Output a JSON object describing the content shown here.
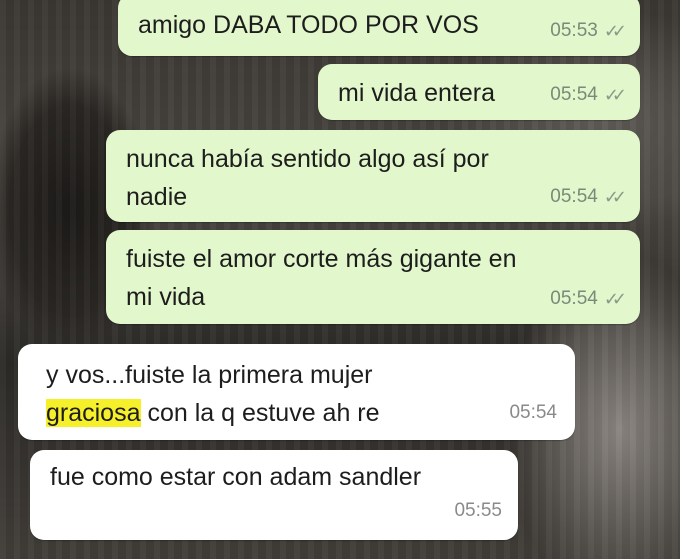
{
  "messages": [
    {
      "text": "amigo DABA TODO POR VOS",
      "time": "05:53",
      "ticks": "✓✓"
    },
    {
      "text": "mi vida entera",
      "time": "05:54",
      "ticks": "✓✓"
    },
    {
      "text": "nunca había sentido algo así por\nnadie",
      "time": "05:54",
      "ticks": "✓✓"
    },
    {
      "text": "fuiste el amor corte más gigante en\nmi vida",
      "time": "05:54",
      "ticks": "✓✓"
    },
    {
      "text_line1": "y vos...fuiste la primera mujer",
      "highlight": "graciosa",
      "text_line2_rest": " con la q estuve ah re",
      "time": "05:54"
    },
    {
      "text": "fue como estar con adam sandler",
      "time": "05:55"
    }
  ],
  "colors": {
    "outgoing": "#e2f7cb",
    "incoming": "#ffffff",
    "highlight": "#f6f02a"
  }
}
